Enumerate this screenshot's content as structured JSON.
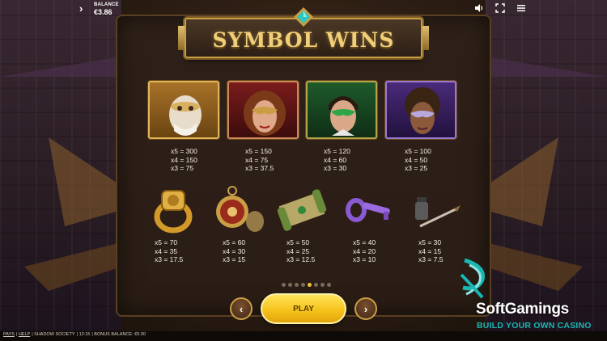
{
  "topbar": {
    "balance_label": "BALANCE",
    "balance_value": "€3.86",
    "icons": [
      "menu-chevron-icon",
      "sound-icon",
      "fullscreen-icon",
      "hamburger-menu-icon"
    ]
  },
  "title": "SYMBOL WINS",
  "symbols_row1": [
    {
      "name": "old-man-masked-character",
      "lines": [
        "x5 = 300",
        "x4 = 150",
        "x3 = 75"
      ],
      "frame": "#d8a64a"
    },
    {
      "name": "red-haired-masked-woman",
      "lines": [
        "x5 = 150",
        "x4 = 75",
        "x3 = 37.5"
      ],
      "frame": "#b83a3a"
    },
    {
      "name": "green-masked-man",
      "lines": [
        "x5 = 120",
        "x4 = 60",
        "x3 = 30"
      ],
      "frame": "#3a9a3a"
    },
    {
      "name": "purple-masked-woman",
      "lines": [
        "x5 = 100",
        "x4 = 50",
        "x3 = 25"
      ],
      "frame": "#7a4ab8"
    }
  ],
  "symbols_row2": [
    {
      "name": "gold-ring",
      "lines": [
        "x5 = 70",
        "x4 = 35",
        "x3 = 17.5"
      ]
    },
    {
      "name": "pocket-watch",
      "lines": [
        "x5 = 60",
        "x4 = 30",
        "x3 = 15"
      ]
    },
    {
      "name": "scroll",
      "lines": [
        "x5 = 50",
        "x4 = 25",
        "x3 = 12.5"
      ]
    },
    {
      "name": "purple-key",
      "lines": [
        "x5 = 40",
        "x4 = 20",
        "x3 = 10"
      ]
    },
    {
      "name": "ink-and-quill",
      "lines": [
        "x5 = 30",
        "x4 = 15",
        "x3 = 7.5"
      ]
    }
  ],
  "pagination": {
    "total": 8,
    "active_index": 4
  },
  "buttons": {
    "play": "PLAY",
    "prev_icon": "chevron-left-icon",
    "next_icon": "chevron-right-icon"
  },
  "watermark": {
    "brand": "SoftGamings",
    "tagline": "BUILD YOUR OWN CASINO"
  },
  "footer": {
    "items": [
      "PAYS",
      "HELP",
      "SHADOW SOCIETY",
      "12:15",
      "BONUS BALANCE: €0.00"
    ]
  },
  "colors": {
    "gold": "#c99e45",
    "title_gold": "#f0cf78",
    "play_yellow": "#f6c31c",
    "brand_teal": "#19b6b2"
  }
}
